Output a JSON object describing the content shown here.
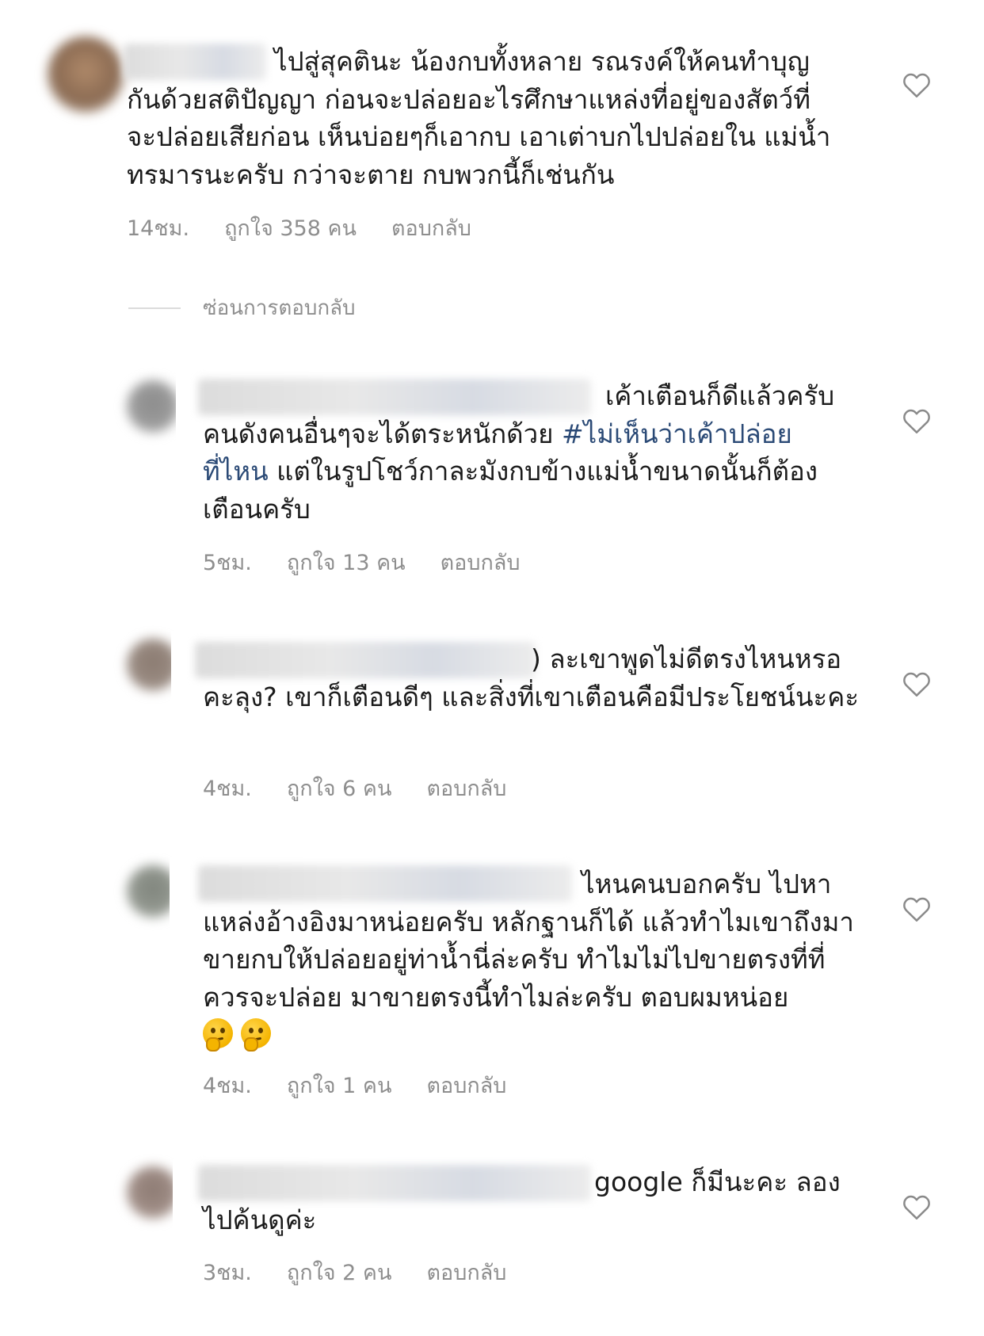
{
  "comments": [
    {
      "text_first": "ไปสู่สุคตินะ น้องกบทั้งหลาย รณรงค์ให้คนทำบุญ",
      "text_rest": "กันด้วยสติปัญญา ก่อนจะปล่อยอะไรศึกษาแหล่งที่อยู่ของสัตว์ที่จะปล่อยเสียก่อน เห็นบ่อยๆก็เอากบ เอาเต่าบกไปปล่อยใน แม่น้ำ ทรมารนะครับ กว่าจะตาย กบพวกนี้ก็เช่นกัน",
      "time": "14ชม.",
      "likes": "ถูกใจ 358 คน",
      "reply": "ตอบกลับ"
    },
    {
      "text_first": "เค้าเตือนก็ดีแล้วครับ",
      "text_pre": "คนดังคนอื่นๆจะได้ตระหนักด้วย ",
      "hashtag": "#ไม่เห็นว่าเค้าปล่อยที่ไหน",
      "text_post": " แต่ในรูปโชว์กาละมังกบข้างแม่น้ำขนาดนั้นก็ต้องเตือนครับ",
      "time": "5ชม.",
      "likes": "ถูกใจ 13 คน",
      "reply": "ตอบกลับ"
    },
    {
      "text_first": ") ละเขาพูดไม่ดีตรงไหนหรอ",
      "text_rest": "คะลุง? เขาก็เตือนดีๆ และสิ่งที่เขาเตือนคือมีประโยชน์นะคะ",
      "time": "4ชม.",
      "likes": "ถูกใจ 6 คน",
      "reply": "ตอบกลับ"
    },
    {
      "text_first": "ไหนคนบอกครับ ไปหา",
      "text_rest": "แหล่งอ้างอิงมาหน่อยครับ หลักฐานก็ได้ แล้วทำไมเขาถึงมาขายกบให้ปล่อยอยู่ท่าน้ำนี่ล่ะครับ ทำไมไม่ไปขายตรงที่ที่ควรจะปล่อย มาขายตรงนี้ทำไมล่ะครับ ตอบผมหน่อย",
      "emoji": "thinking-face-icon",
      "time": "4ชม.",
      "likes": "ถูกใจ 1 คน",
      "reply": "ตอบกลับ"
    },
    {
      "text_first": "google ก็มีนะคะ ลอง",
      "text_rest": "ไปค้นดูค่ะ",
      "time": "3ชม.",
      "likes": "ถูกใจ 2 คน",
      "reply": "ตอบกลับ"
    }
  ],
  "hide_replies_label": "ซ่อนการตอบกลับ",
  "icons": {
    "like": "heart-outline-icon"
  },
  "colors": {
    "text": "#1b1b1b",
    "meta": "#8e8e8e",
    "hashtag": "#2b4a76",
    "divider": "#dbdbdb"
  }
}
